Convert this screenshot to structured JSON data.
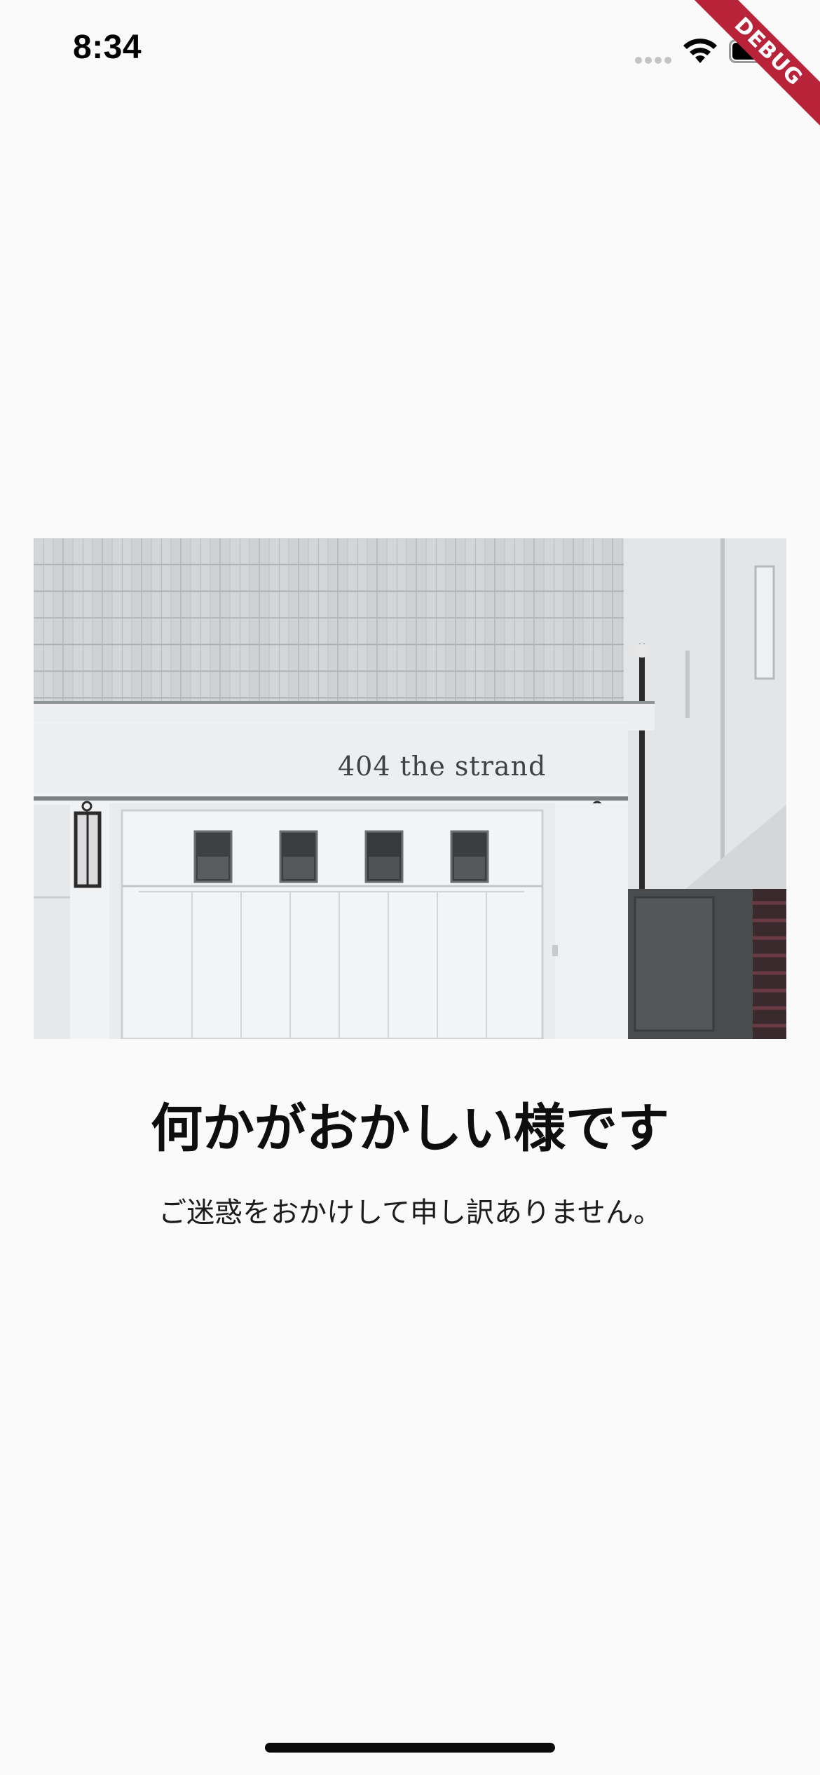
{
  "status_bar": {
    "time": "8:34",
    "icons": [
      "signal-dots-icon",
      "wifi-icon",
      "battery-icon"
    ]
  },
  "debug_banner": {
    "label": "DEBUG",
    "color": "#b8233a"
  },
  "hero_image": {
    "sign_text": "404 the strand",
    "description_icon": "garage-photo"
  },
  "error": {
    "title": "何かがおかしい様です",
    "message": "ご迷惑をおかけして申し訳ありません。"
  },
  "colors": {
    "background": "#fafafa",
    "text": "#0e0e0e"
  }
}
